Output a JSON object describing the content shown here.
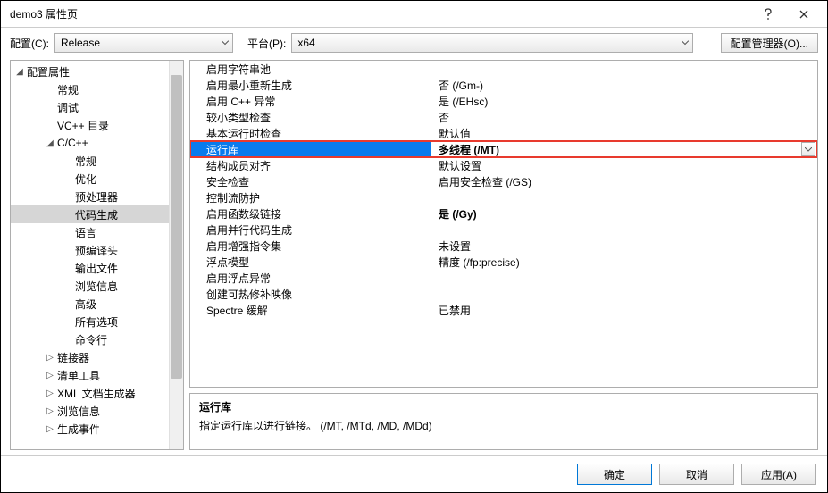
{
  "window": {
    "title": "demo3 属性页"
  },
  "topbar": {
    "config_label": "配置(C):",
    "config_value": "Release",
    "platform_label": "平台(P):",
    "platform_value": "x64",
    "manager_label": "配置管理器(O)..."
  },
  "tree": {
    "root": "配置属性",
    "items": [
      {
        "label": "常规",
        "level": 2
      },
      {
        "label": "调试",
        "level": 2
      },
      {
        "label": "VC++ 目录",
        "level": 2
      },
      {
        "label": "C/C++",
        "level": 2,
        "expandable": true,
        "expanded": true
      },
      {
        "label": "常规",
        "level": 3
      },
      {
        "label": "优化",
        "level": 3
      },
      {
        "label": "预处理器",
        "level": 3
      },
      {
        "label": "代码生成",
        "level": 3,
        "selected": true
      },
      {
        "label": "语言",
        "level": 3
      },
      {
        "label": "预编译头",
        "level": 3
      },
      {
        "label": "输出文件",
        "level": 3
      },
      {
        "label": "浏览信息",
        "level": 3
      },
      {
        "label": "高级",
        "level": 3
      },
      {
        "label": "所有选项",
        "level": 3
      },
      {
        "label": "命令行",
        "level": 3
      },
      {
        "label": "链接器",
        "level": 2,
        "expandable": true,
        "expanded": false
      },
      {
        "label": "清单工具",
        "level": 2,
        "expandable": true,
        "expanded": false
      },
      {
        "label": "XML 文档生成器",
        "level": 2,
        "expandable": true,
        "expanded": false
      },
      {
        "label": "浏览信息",
        "level": 2,
        "expandable": true,
        "expanded": false
      },
      {
        "label": "生成事件",
        "level": 2,
        "expandable": true,
        "expanded": false
      }
    ]
  },
  "grid": {
    "rows": [
      {
        "name": "启用字符串池",
        "value": ""
      },
      {
        "name": "启用最小重新生成",
        "value": "否 (/Gm-)"
      },
      {
        "name": "启用 C++ 异常",
        "value": "是 (/EHsc)"
      },
      {
        "name": "较小类型检查",
        "value": "否"
      },
      {
        "name": "基本运行时检查",
        "value": "默认值"
      },
      {
        "name": "运行库",
        "value": "多线程 (/MT)",
        "highlight": true,
        "bold": true
      },
      {
        "name": "结构成员对齐",
        "value": "默认设置"
      },
      {
        "name": "安全检查",
        "value": "启用安全检查 (/GS)"
      },
      {
        "name": "控制流防护",
        "value": ""
      },
      {
        "name": "启用函数级链接",
        "value": "是 (/Gy)",
        "bold": true
      },
      {
        "name": "启用并行代码生成",
        "value": ""
      },
      {
        "name": "启用增强指令集",
        "value": "未设置"
      },
      {
        "name": "浮点模型",
        "value": "精度 (/fp:precise)"
      },
      {
        "name": "启用浮点异常",
        "value": ""
      },
      {
        "name": "创建可热修补映像",
        "value": ""
      },
      {
        "name": "Spectre 缓解",
        "value": "已禁用"
      }
    ]
  },
  "desc": {
    "title": "运行库",
    "text": "指定运行库以进行链接。     (/MT, /MTd, /MD, /MDd)"
  },
  "footer": {
    "ok": "确定",
    "cancel": "取消",
    "apply": "应用(A)"
  }
}
